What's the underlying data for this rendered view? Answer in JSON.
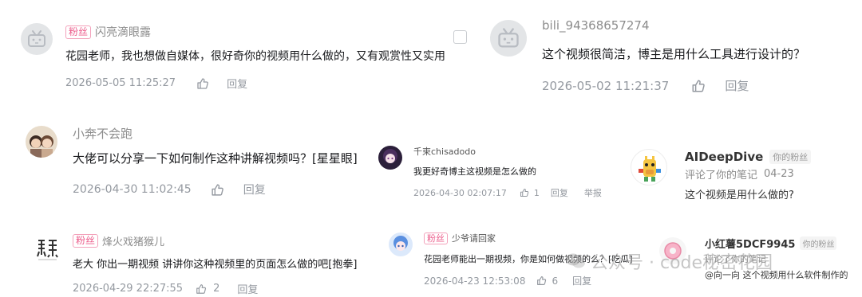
{
  "comments": [
    {
      "badge": "粉丝",
      "username": "闪亮滴眼露",
      "text": "花园老师，我也想做自媒体，很好奇你的视频用什么做的，又有观赏性又实用",
      "time": "2026-05-05 11:25:27",
      "reply_label": "回复"
    },
    {
      "username": "bili_94368657274",
      "text": "这个视频很简洁，博主是用什么工具进行设计的？",
      "time": "2026-05-02 11:21:37",
      "reply_label": "回复"
    },
    {
      "username": "小奔不会跑",
      "text": "大佬可以分享一下如何制作这种讲解视频吗？[星星眼]",
      "time": "2026-04-30 11:02:45",
      "reply_label": "回复"
    },
    {
      "username": "千束chisadodo",
      "text": "我更好奇博主这视频是怎么做的",
      "time": "2026-04-30 02:07:17",
      "like_count": "1",
      "reply_label": "回复",
      "report_label": "举报"
    },
    {
      "username": "AIDeepDive",
      "fan_tag": "你的粉丝",
      "subtitle": "评论了你的笔记",
      "date": "04-23",
      "text": "这个视频是用什么做的?"
    },
    {
      "badge": "粉丝",
      "username": "烽火戏猪猴儿",
      "text": "老大 你出一期视频   讲讲你这种视频里的页面怎么做的吧[抱拳]",
      "time": "2026-04-29 22:27:55",
      "like_count": "2",
      "reply_label": "回复"
    },
    {
      "badge": "粉丝",
      "username": "少爷请回家",
      "text": "花园老师能出一期视频，你是如何做视频的么？[吃瓜]",
      "time": "2026-04-23 12:53:08",
      "like_count": "6",
      "reply_label": "回复"
    },
    {
      "username": "小红薯5DCF9945",
      "fan_tag": "你的粉丝",
      "subtitle": "评论了你的笔记",
      "text": "@向一向 这个视频用什么软件制作的"
    }
  ],
  "watermark": "公众号 · code秘密花园",
  "icons": [
    "bilibili-tv-icon",
    "thumb-up-icon",
    "wechat-icon",
    "donut-icon"
  ],
  "colors": {
    "badge_pink": "#ec5b8a",
    "gray_text": "#9499a0",
    "main_text": "#18191c"
  }
}
